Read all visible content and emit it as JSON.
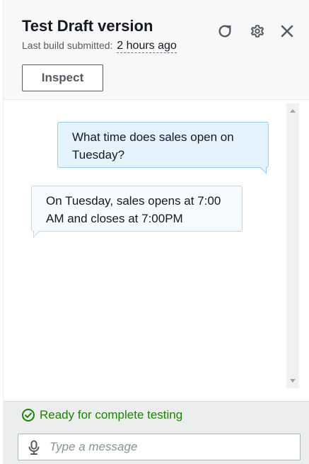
{
  "header": {
    "title": "Test Draft version",
    "subtitle_prefix": "Last build submitted:",
    "subtitle_time": "2 hours ago",
    "inspect_label": "Inspect",
    "icons": [
      "refresh-icon",
      "settings-icon",
      "close-icon"
    ]
  },
  "messages": [
    {
      "sender": "user",
      "text": "What time does sales open on Tuesday?"
    },
    {
      "sender": "bot",
      "text": "On Tuesday, sales opens at 7:00 AM and closes at 7:00PM"
    }
  ],
  "footer": {
    "status": "Ready for complete testing",
    "input_placeholder": "Type a message"
  },
  "colors": {
    "status_green": "#1d8102",
    "user_bubble": "#e3f2fd",
    "bot_bubble": "#f6fafd"
  }
}
